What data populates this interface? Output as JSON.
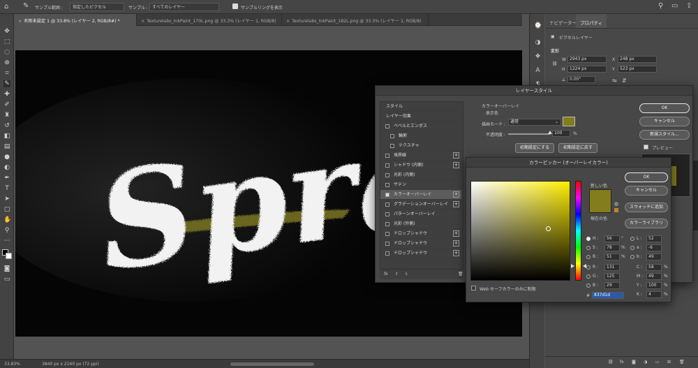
{
  "optionsbar": {
    "sample_size_label": "サンプル範囲 :",
    "sample_size_value": "指定したピクセル",
    "sample_label": "サンプル :",
    "sample_value": "すべてのレイヤー",
    "show_ring_label": "サンプルリングを表示"
  },
  "tabs": [
    {
      "label": "名称未設定 1 @ 33.8% (レイヤー 2, RGB/8#) *"
    },
    {
      "label": "Texturelabs_InkPaint_170L.png @ 33.3% (レイヤー 1, RGB/8)"
    },
    {
      "label": "Texturelabs_InkPaint_182L.png @ 33.3% (レイヤー 1, RGB/8)"
    }
  ],
  "canvas": {
    "text": "Spra",
    "color_overlay": "#837d1d"
  },
  "status": {
    "zoom": "33.83%",
    "doc_info": "3840 px x 2160 px (72 ppi)"
  },
  "panel": {
    "tabs": [
      "ナビゲーター",
      "プロパティ"
    ],
    "layer_type": "ピクセルレイヤー",
    "transform_title": "変形",
    "w_label": "W",
    "w_value": "2943 px",
    "x_label": "X",
    "x_value": "248 px",
    "h_label": "H",
    "h_value": "1224 px",
    "y_label": "Y",
    "y_value": "523 px",
    "angle_value": "0.00°"
  },
  "layer_style": {
    "title": "レイヤースタイル",
    "styles_header": "スタイル",
    "effects_header": "レイヤー効果",
    "items": [
      {
        "label": "ベベルとエンボス",
        "checked": false,
        "plus": false,
        "indent": false
      },
      {
        "label": "輪郭",
        "checked": false,
        "plus": false,
        "indent": true
      },
      {
        "label": "テクスチャ",
        "checked": false,
        "plus": false,
        "indent": true
      },
      {
        "label": "境界線",
        "checked": false,
        "plus": true,
        "indent": false
      },
      {
        "label": "シャドウ (内側)",
        "checked": false,
        "plus": true,
        "indent": false
      },
      {
        "label": "光彩 (内側)",
        "checked": false,
        "plus": false,
        "indent": false
      },
      {
        "label": "サテン",
        "checked": false,
        "plus": false,
        "indent": false
      },
      {
        "label": "カラーオーバーレイ",
        "checked": true,
        "plus": true,
        "indent": false
      },
      {
        "label": "グラデーションオーバーレイ",
        "checked": false,
        "plus": true,
        "indent": false
      },
      {
        "label": "パターンオーバーレイ",
        "checked": false,
        "plus": false,
        "indent": false
      },
      {
        "label": "光彩 (外側)",
        "checked": false,
        "plus": false,
        "indent": false
      },
      {
        "label": "ドロップシャドウ",
        "checked": false,
        "plus": true,
        "indent": false
      },
      {
        "label": "ドロップシャドウ",
        "checked": false,
        "plus": true,
        "indent": false
      },
      {
        "label": "ドロップシャドウ",
        "checked": false,
        "plus": true,
        "indent": false
      }
    ],
    "fx_label": "fx",
    "section_title": "カラーオーバーレイ",
    "sub_title": "表示色",
    "blend_label": "描画モード :",
    "blend_value": "通常",
    "opacity_label": "不透明度 :",
    "opacity_value": "100",
    "opacity_unit": "%",
    "opacity_fraction": 1.0,
    "make_default": "初期設定にする",
    "reset_default": "初期設定に戻す",
    "ok": "OK",
    "cancel": "キャンセル",
    "new_style": "新規スタイル...",
    "preview": "プレビュー"
  },
  "color_picker": {
    "title": "カラーピッカー (オーバーレイカラー)",
    "ok": "OK",
    "cancel": "キャンセル",
    "add_swatch": "スウォッチに追加",
    "color_libraries": "カラーライブラリ",
    "new_label": "新しい色",
    "current_label": "現在の色",
    "hex_label": "#",
    "hex_value": "837d1d",
    "web_safe": "Web セーフカラーのみに制限",
    "color": "#837d1d",
    "H_label": "H :",
    "H_value": "56",
    "H_unit": "°",
    "S_label": "S :",
    "S_value": "78",
    "S_unit": "%",
    "B_label": "B :",
    "B_value": "51",
    "B_unit": "%",
    "R_label": "R :",
    "R_value": "131",
    "G_label": "G :",
    "G_value": "125",
    "Bl_label": "B :",
    "Bl_value": "29",
    "L_label": "L :",
    "L_value": "52",
    "a_label": "a :",
    "a_value": "-6",
    "b_label": "b :",
    "b_value": "49",
    "C_label": "C :",
    "C_value": "58",
    "C_unit": "%",
    "M_label": "M :",
    "M_value": "49",
    "M_unit": "%",
    "Y_label": "Y :",
    "Y_value": "100",
    "Y_unit": "%",
    "K_label": "K :",
    "K_value": "4",
    "K_unit": "%"
  }
}
